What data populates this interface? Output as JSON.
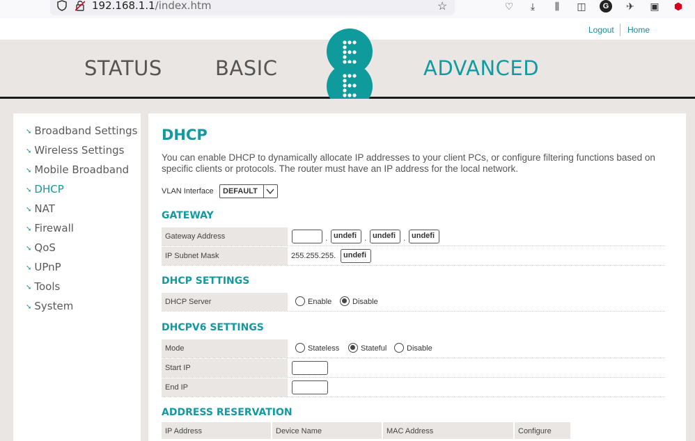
{
  "browser": {
    "url_host": "192.168.1.1",
    "url_path": "/index.htm"
  },
  "top_links": {
    "logout": "Logout",
    "home": "Home"
  },
  "nav": {
    "status": "STATUS",
    "basic": "BASIC",
    "advanced": "ADVANCED"
  },
  "logo": {
    "letter_top": "E",
    "letter_bottom": "E"
  },
  "sidebar": {
    "items": [
      {
        "label": "Broadband Settings"
      },
      {
        "label": "Wireless Settings"
      },
      {
        "label": "Mobile Broadband"
      },
      {
        "label": "DHCP"
      },
      {
        "label": "NAT"
      },
      {
        "label": "Firewall"
      },
      {
        "label": "QoS"
      },
      {
        "label": "UPnP"
      },
      {
        "label": "Tools"
      },
      {
        "label": "System"
      }
    ],
    "active": "DHCP"
  },
  "main": {
    "title": "DHCP",
    "description": "You can enable DHCP to dynamically allocate IP addresses to your client PCs, or configure filtering functions based on specific clients or protocols. The router must have an IP address for the local network.",
    "vlan_label": "VLAN Interface",
    "vlan_value": "DEFAULT",
    "gateway": {
      "title": "GATEWAY",
      "address_label": "Gateway Address",
      "address_octets": [
        "",
        "undefi",
        "undefi",
        "undefi"
      ],
      "subnet_label": "IP Subnet Mask",
      "subnet_prefix": "255.255.255.",
      "subnet_last": "undefi"
    },
    "dhcp_settings": {
      "title": "DHCP SETTINGS",
      "server_label": "DHCP Server",
      "enable": "Enable",
      "disable": "Disable",
      "selected": "Disable"
    },
    "dhcpv6": {
      "title": "DHCPV6 SETTINGS",
      "mode_label": "Mode",
      "stateless": "Stateless",
      "stateful": "Stateful",
      "disable": "Disable",
      "selected": "Stateful",
      "start_ip_label": "Start IP",
      "end_ip_label": "End IP"
    },
    "reservation": {
      "title": "ADDRESS RESERVATION",
      "columns": [
        "IP Address",
        "Device Name",
        "MAC Address",
        "Configure"
      ]
    }
  },
  "colors": {
    "accent": "#139aa0",
    "band": "#e9e6e3"
  }
}
